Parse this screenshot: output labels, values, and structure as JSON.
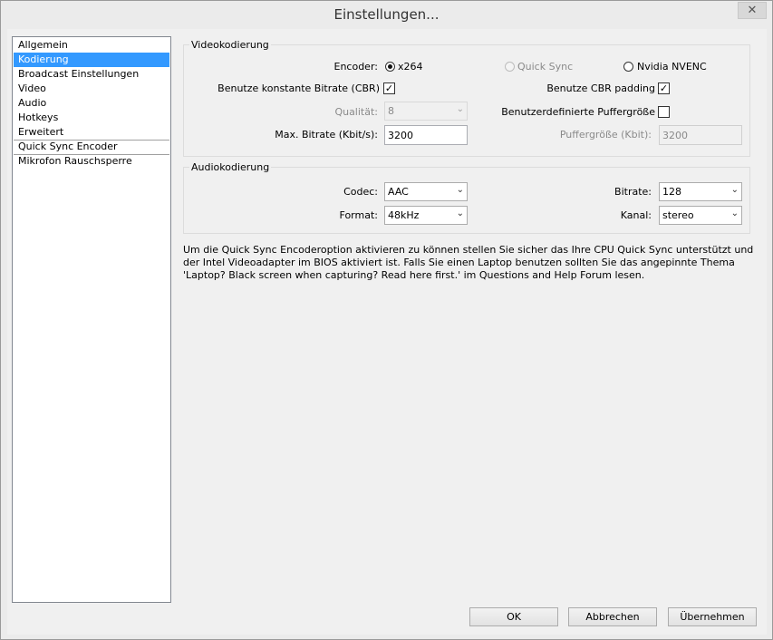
{
  "window": {
    "title": "Einstellungen...",
    "close_glyph": "✕"
  },
  "sidebar": {
    "items": [
      {
        "label": "Allgemein",
        "selected": false
      },
      {
        "label": "Kodierung",
        "selected": true
      },
      {
        "label": "Broadcast Einstellungen",
        "selected": false
      },
      {
        "label": "Video",
        "selected": false
      },
      {
        "label": "Audio",
        "selected": false
      },
      {
        "label": "Hotkeys",
        "selected": false
      },
      {
        "label": "Erweitert",
        "selected": false
      },
      {
        "label": "Quick Sync Encoder",
        "selected": false
      },
      {
        "label": "Mikrofon Rauschsperre",
        "selected": false
      }
    ]
  },
  "video": {
    "group_title": "Videokodierung",
    "encoder_label": "Encoder:",
    "encoder_options": [
      {
        "label": "x264",
        "checked": true,
        "disabled": false
      },
      {
        "label": "Quick Sync",
        "checked": false,
        "disabled": true
      },
      {
        "label": "Nvidia NVENC",
        "checked": false,
        "disabled": false
      }
    ],
    "cbr_label": "Benutze konstante Bitrate (CBR)",
    "cbr_checked": true,
    "cbr_padding_label": "Benutze CBR padding",
    "cbr_padding_checked": true,
    "quality_label": "Qualität:",
    "quality_value": "8",
    "custom_buffer_label": "Benutzerdefinierte Puffergröße",
    "custom_buffer_checked": false,
    "max_bitrate_label": "Max. Bitrate (Kbit/s):",
    "max_bitrate_value": "3200",
    "buffer_size_label": "Puffergröße (Kbit):",
    "buffer_size_value": "3200",
    "check_glyph": "✓"
  },
  "audio": {
    "group_title": "Audiokodierung",
    "codec_label": "Codec:",
    "codec_value": "AAC",
    "bitrate_label": "Bitrate:",
    "bitrate_value": "128",
    "format_label": "Format:",
    "format_value": "48kHz",
    "channel_label": "Kanal:",
    "channel_value": "stereo",
    "arrow_glyph": "⌄"
  },
  "info_text": "Um die Quick Sync Encoderoption aktivieren zu können stellen Sie sicher das Ihre CPU Quick Sync unterstützt und der Intel Videoadapter im BIOS aktiviert ist. Falls Sie einen Laptop benutzen sollten Sie das angepinnte Thema 'Laptop? Black screen when capturing? Read here first.' im Questions and Help Forum lesen.",
  "buttons": {
    "ok": "OK",
    "cancel": "Abbrechen",
    "apply": "Übernehmen"
  }
}
